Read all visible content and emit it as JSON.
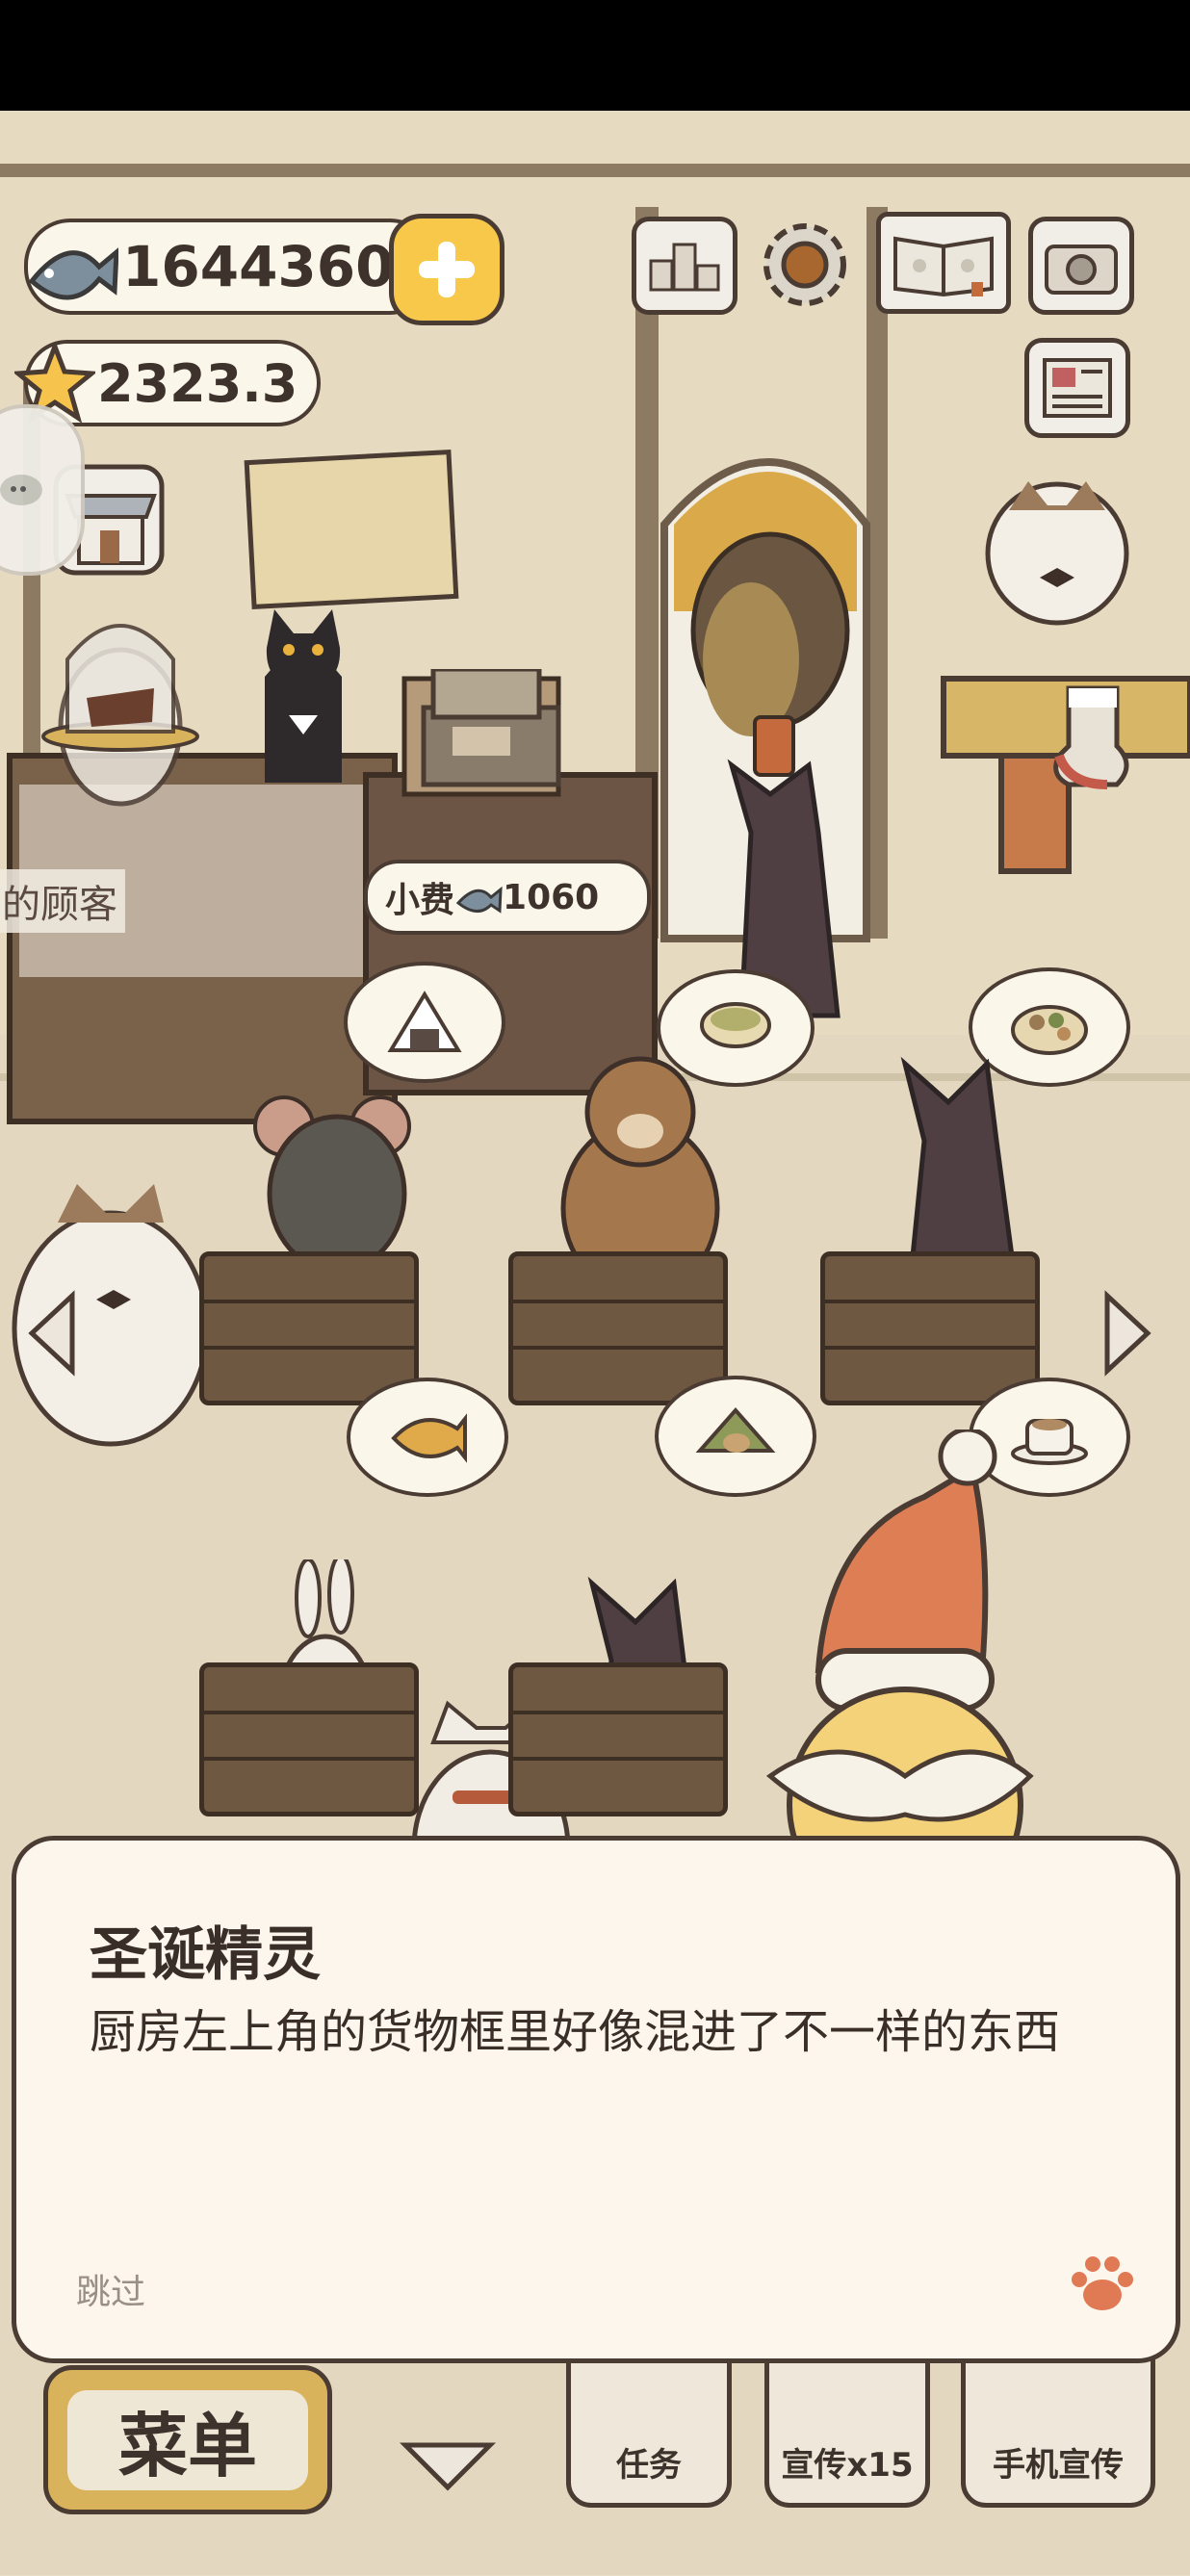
{
  "status_bar": {},
  "hud": {
    "fish_amount": "1644360",
    "star_amount": "2323.3"
  },
  "shop": {
    "side_sign": "的顾客",
    "tip_label": "小费",
    "tip_amount": "1060"
  },
  "dialog": {
    "speaker": "圣诞精灵",
    "message": "厨房左上角的货物框里好像混进了不一样的东西",
    "skip": "跳过"
  },
  "bottom_bar": {
    "menu": "菜单",
    "tasks": "任务",
    "promote": "宣传x15",
    "phone_promote": "手机宣传"
  },
  "colors": {
    "background": "#e9dfc6",
    "outline": "#4a3b33",
    "plus_button": "#f7c84a",
    "dialog_bg": "#fcf6ec",
    "paw": "#e07a55"
  },
  "icons": [
    "fish-icon",
    "plus-icon",
    "star-icon",
    "leaderboard-icon",
    "settings-gear-icon",
    "recipe-book-icon",
    "camera-icon",
    "newspaper-icon",
    "shop-icon",
    "chat-icon",
    "paw-icon",
    "left-arrow-icon",
    "right-arrow-icon",
    "down-arrow-icon",
    "check-icon"
  ]
}
